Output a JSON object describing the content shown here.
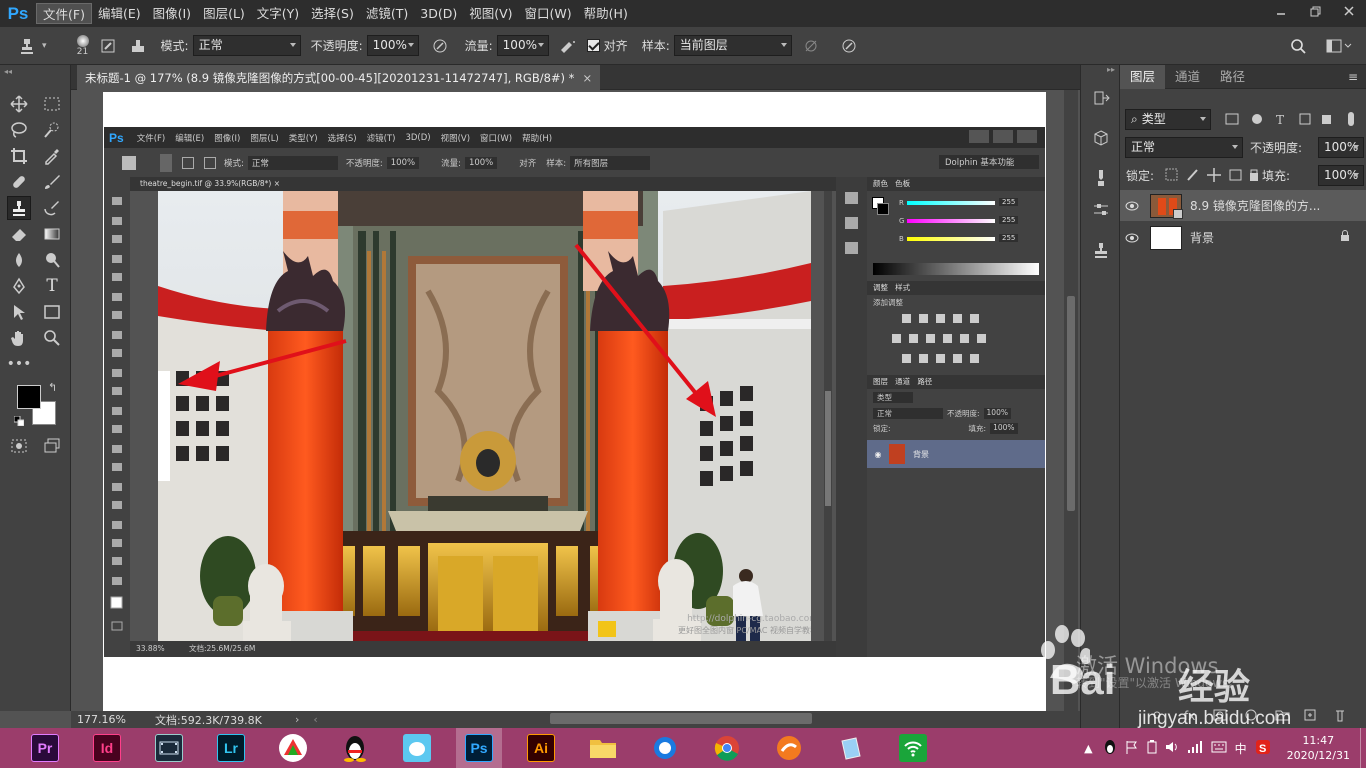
{
  "app": {
    "logo": "Ps"
  },
  "menu": [
    "文件(F)",
    "编辑(E)",
    "图像(I)",
    "图层(L)",
    "文字(Y)",
    "选择(S)",
    "滤镜(T)",
    "3D(D)",
    "视图(V)",
    "窗口(W)",
    "帮助(H)"
  ],
  "options": {
    "brush_size": "21",
    "mode_label": "模式:",
    "mode_value": "正常",
    "opacity_label": "不透明度:",
    "opacity_value": "100%",
    "flow_label": "流量:",
    "flow_value": "100%",
    "align_label": "对齐",
    "sample_label": "样本:",
    "sample_value": "当前图层"
  },
  "document": {
    "tab_title": "未标题-1 @ 177% (8.9 镜像克隆图像的方式[00-00-45][20201231-11472747], RGB/8#) *",
    "close": "×"
  },
  "status": {
    "zoom": "177.16%",
    "doc_info": "文档:592.3K/739.8K"
  },
  "inner_screenshot": {
    "logo": "Ps",
    "menu": [
      "文件(F)",
      "编辑(E)",
      "图像(I)",
      "图层(L)",
      "类型(Y)",
      "选择(S)",
      "滤镜(T)",
      "3D(D)",
      "视图(V)",
      "窗口(W)",
      "帮助(H)"
    ],
    "tab_title": "theatre_begin.tif @ 33.9%(RGB/8*)",
    "status_zoom": "33.88%",
    "status_doc": "文档:25.6M/25.6M",
    "workspace": "Dolphin 基本功能",
    "mode": "正常",
    "opacity_label": "不透明度:",
    "opacity": "100%",
    "flow_label": "流量:",
    "flow": "100%",
    "align": "对齐",
    "sample_label": "样本:",
    "sample": "所有图层",
    "panel_color_tabs": [
      "颜色",
      "色板"
    ],
    "panel_adjust_tabs": [
      "调整",
      "样式"
    ],
    "adjust_label": "添加调整",
    "panel_layer_tabs": [
      "图层",
      "通道",
      "路径"
    ],
    "layer_kind": "类型",
    "layer_mode": "正常",
    "layer_opacity_label": "不透明度:",
    "layer_opacity": "100%",
    "lock_label": "锁定:",
    "fill_label": "填充:",
    "fill": "100%",
    "layer_name": "背景",
    "rgb_labels": [
      "R",
      "G",
      "B"
    ],
    "rgb_values": [
      "255",
      "255",
      "255"
    ],
    "photo_watermark": "http://dolphin-cg.taobao.com",
    "photo_watermark2": "更好图全图内窗 PC/MAC 视频自学教程"
  },
  "layers_panel": {
    "tabs": [
      "图层",
      "通道",
      "路径"
    ],
    "kind": "类型",
    "mode": "正常",
    "opacity_label": "不透明度:",
    "opacity": "100%",
    "lock_label": "锁定:",
    "fill_label": "填充:",
    "fill": "100%",
    "layers": [
      {
        "name": "8.9 镜像克隆图像的方..."
      },
      {
        "name": "背景"
      }
    ]
  },
  "taskbar": {
    "apps": [
      "Pr",
      "Id",
      "",
      "Lr",
      "",
      "",
      "",
      "Ps",
      "Ai",
      "",
      "",
      "",
      "",
      "",
      ""
    ],
    "tray_time": "11:47",
    "tray_date": "2020/12/31",
    "ime": "中"
  },
  "overlay": {
    "activate": "激活 Windows",
    "activate_sub": "转到\"设置\"以激活 Windows。",
    "baidu": "Bai",
    "baidu_cn": "经验",
    "site": "jingyan.baidu.com"
  },
  "colors": {
    "ps_blue": "#31a8ff",
    "arrow": "#e0101a",
    "taskbar": "#9b3d6b"
  }
}
